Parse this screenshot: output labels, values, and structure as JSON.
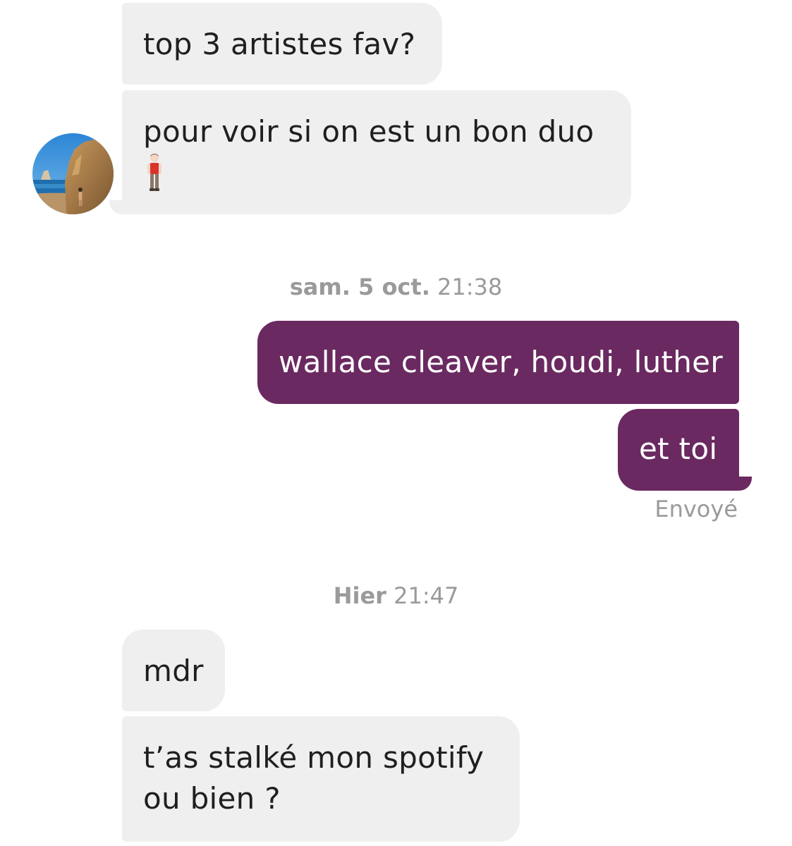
{
  "conversation": {
    "messages": [
      {
        "direction": "incoming",
        "text": "top 3 artistes fav?"
      },
      {
        "direction": "incoming",
        "text": "pour voir si on est un bon duo"
      },
      {
        "direction": "outgoing",
        "text": "wallace cleaver, houdi, luther"
      },
      {
        "direction": "outgoing",
        "text": "et toi"
      },
      {
        "direction": "incoming",
        "text": "mdr"
      },
      {
        "direction": "incoming",
        "line1": "t’as stalké mon spotify",
        "line2": "ou bien ?"
      }
    ],
    "timestamps": [
      {
        "day": "sam. 5 oct.",
        "time": "21:38"
      },
      {
        "day": "Hier",
        "time": "21:47"
      }
    ],
    "sent_status": "Envoyé",
    "emoji": "man-standing-emoji"
  },
  "colors": {
    "incoming_bubble": "#f0eff0",
    "outgoing_bubble": "#6a2960",
    "meta_text": "#9a9a9a"
  }
}
